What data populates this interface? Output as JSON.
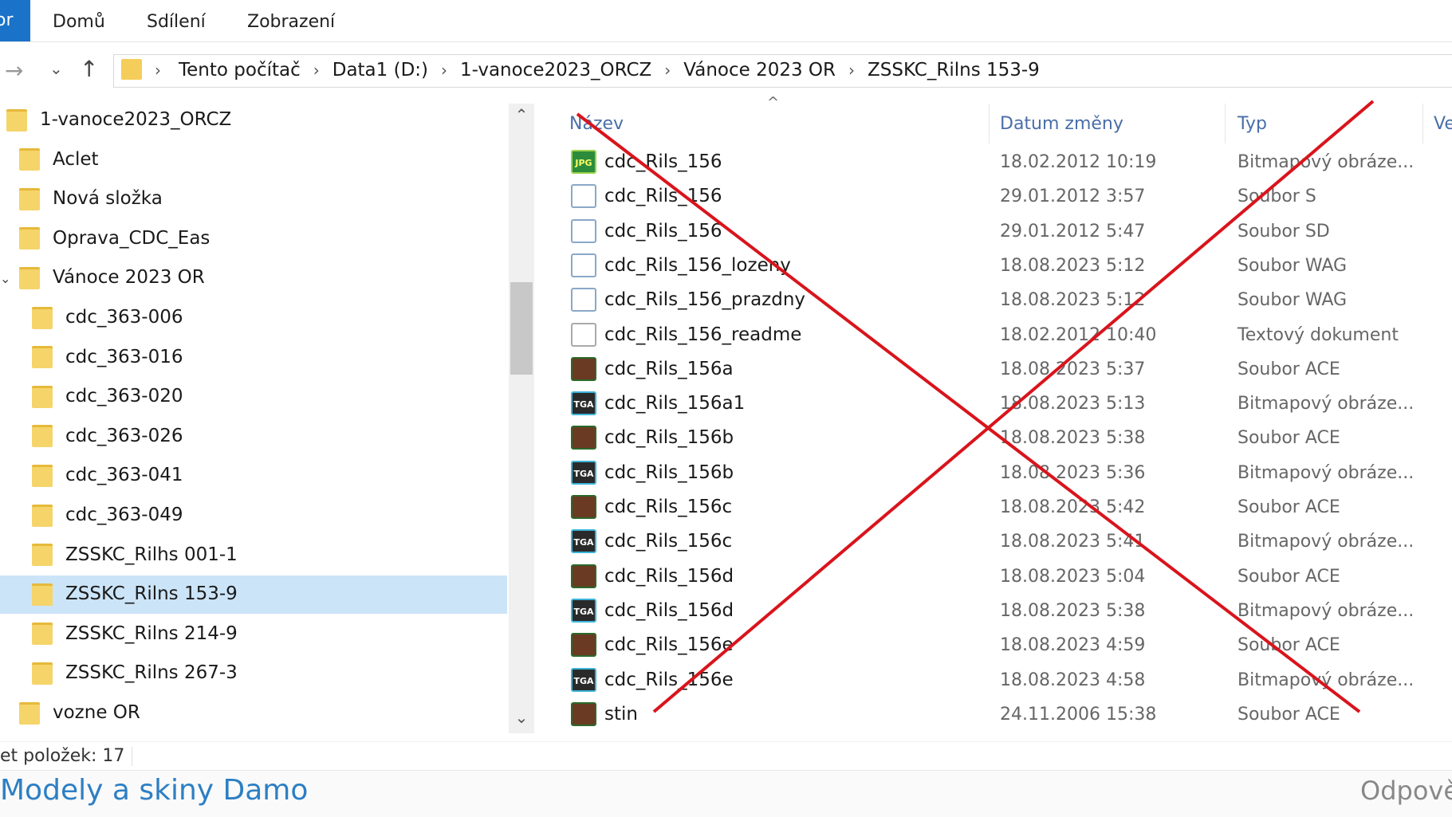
{
  "ribbon": {
    "file_tab": "or",
    "tabs": [
      "Domů",
      "Sdílení",
      "Zobrazení"
    ]
  },
  "address": {
    "crumbs": [
      "Tento počítač",
      "Data1 (D:)",
      "1-vanoce2023_ORCZ",
      "Vánoce 2023 OR",
      "ZSSKC_Rilns 153-9"
    ]
  },
  "tree": {
    "items": [
      {
        "label": "1-vanoce2023_ORCZ",
        "level": 0
      },
      {
        "label": "Aclet",
        "level": 1
      },
      {
        "label": "Nová složka",
        "level": 1
      },
      {
        "label": "Oprava_CDC_Eas",
        "level": 1
      },
      {
        "label": "Vánoce 2023 OR",
        "level": 1
      },
      {
        "label": "cdc_363-006",
        "level": 2
      },
      {
        "label": "cdc_363-016",
        "level": 2
      },
      {
        "label": "cdc_363-020",
        "level": 2
      },
      {
        "label": "cdc_363-026",
        "level": 2
      },
      {
        "label": "cdc_363-041",
        "level": 2
      },
      {
        "label": "cdc_363-049",
        "level": 2
      },
      {
        "label": "ZSSKC_Rilhs 001-1",
        "level": 2
      },
      {
        "label": "ZSSKC_Rilns 153-9",
        "level": 2,
        "selected": true
      },
      {
        "label": "ZSSKC_Rilns 214-9",
        "level": 2
      },
      {
        "label": "ZSSKC_Rilns 267-3",
        "level": 2
      },
      {
        "label": "vozne OR",
        "level": 1
      }
    ]
  },
  "columns": {
    "name": "Název",
    "date": "Datum změny",
    "type": "Typ",
    "size": "Ve"
  },
  "files": [
    {
      "icon": "jpg-file-icon",
      "badge": "JPG",
      "kind": "jpg",
      "name": "cdc_Rils_156",
      "date": "18.02.2012 10:19",
      "type": "Bitmapový obráze..."
    },
    {
      "icon": "generic-file-icon",
      "badge": "",
      "kind": "doc",
      "name": "cdc_Rils_156",
      "date": "29.01.2012 3:57",
      "type": "Soubor S"
    },
    {
      "icon": "generic-file-icon",
      "badge": "",
      "kind": "doc",
      "name": "cdc_Rils_156",
      "date": "29.01.2012 5:47",
      "type": "Soubor SD"
    },
    {
      "icon": "generic-file-icon",
      "badge": "",
      "kind": "doc",
      "name": "cdc_Rils_156_lozeny",
      "date": "18.08.2023 5:12",
      "type": "Soubor WAG"
    },
    {
      "icon": "generic-file-icon",
      "badge": "",
      "kind": "doc",
      "name": "cdc_Rils_156_prazdny",
      "date": "18.08.2023 5:12",
      "type": "Soubor WAG"
    },
    {
      "icon": "text-file-icon",
      "badge": "",
      "kind": "txt",
      "name": "cdc_Rils_156_readme",
      "date": "18.02.2012 10:40",
      "type": "Textový dokument"
    },
    {
      "icon": "ace-texture-icon",
      "badge": "",
      "kind": "ace",
      "name": "cdc_Rils_156a",
      "date": "18.08.2023 5:37",
      "type": "Soubor ACE"
    },
    {
      "icon": "tga-file-icon",
      "badge": "TGA",
      "kind": "tga",
      "name": "cdc_Rils_156a1",
      "date": "18.08.2023 5:13",
      "type": "Bitmapový obráze..."
    },
    {
      "icon": "ace-texture-icon",
      "badge": "",
      "kind": "ace",
      "name": "cdc_Rils_156b",
      "date": "18.08.2023 5:38",
      "type": "Soubor ACE"
    },
    {
      "icon": "tga-file-icon",
      "badge": "TGA",
      "kind": "tga",
      "name": "cdc_Rils_156b",
      "date": "18.08.2023 5:36",
      "type": "Bitmapový obráze..."
    },
    {
      "icon": "ace-texture-icon",
      "badge": "",
      "kind": "ace",
      "name": "cdc_Rils_156c",
      "date": "18.08.2023 5:42",
      "type": "Soubor ACE"
    },
    {
      "icon": "tga-file-icon",
      "badge": "TGA",
      "kind": "tga",
      "name": "cdc_Rils_156c",
      "date": "18.08.2023 5:41",
      "type": "Bitmapový obráze..."
    },
    {
      "icon": "ace-texture-icon",
      "badge": "",
      "kind": "ace",
      "name": "cdc_Rils_156d",
      "date": "18.08.2023 5:04",
      "type": "Soubor ACE"
    },
    {
      "icon": "tga-file-icon",
      "badge": "TGA",
      "kind": "tga",
      "name": "cdc_Rils_156d",
      "date": "18.08.2023 5:38",
      "type": "Bitmapový obráze..."
    },
    {
      "icon": "ace-texture-icon",
      "badge": "",
      "kind": "ace",
      "name": "cdc_Rils_156e",
      "date": "18.08.2023 4:59",
      "type": "Soubor ACE"
    },
    {
      "icon": "tga-file-icon",
      "badge": "TGA",
      "kind": "tga",
      "name": "cdc_Rils_156e",
      "date": "18.08.2023 4:58",
      "type": "Bitmapový obráze..."
    },
    {
      "icon": "ace-texture-icon",
      "badge": "",
      "kind": "ace",
      "name": "stin",
      "date": "24.11.2006 15:38",
      "type": "Soubor ACE"
    }
  ],
  "status": {
    "item_count": "et položek: 17"
  },
  "forum": {
    "title": "Modely a skiny Damo",
    "reply": "Odpově"
  },
  "overlay": {
    "cross_color": "#d9141c"
  }
}
